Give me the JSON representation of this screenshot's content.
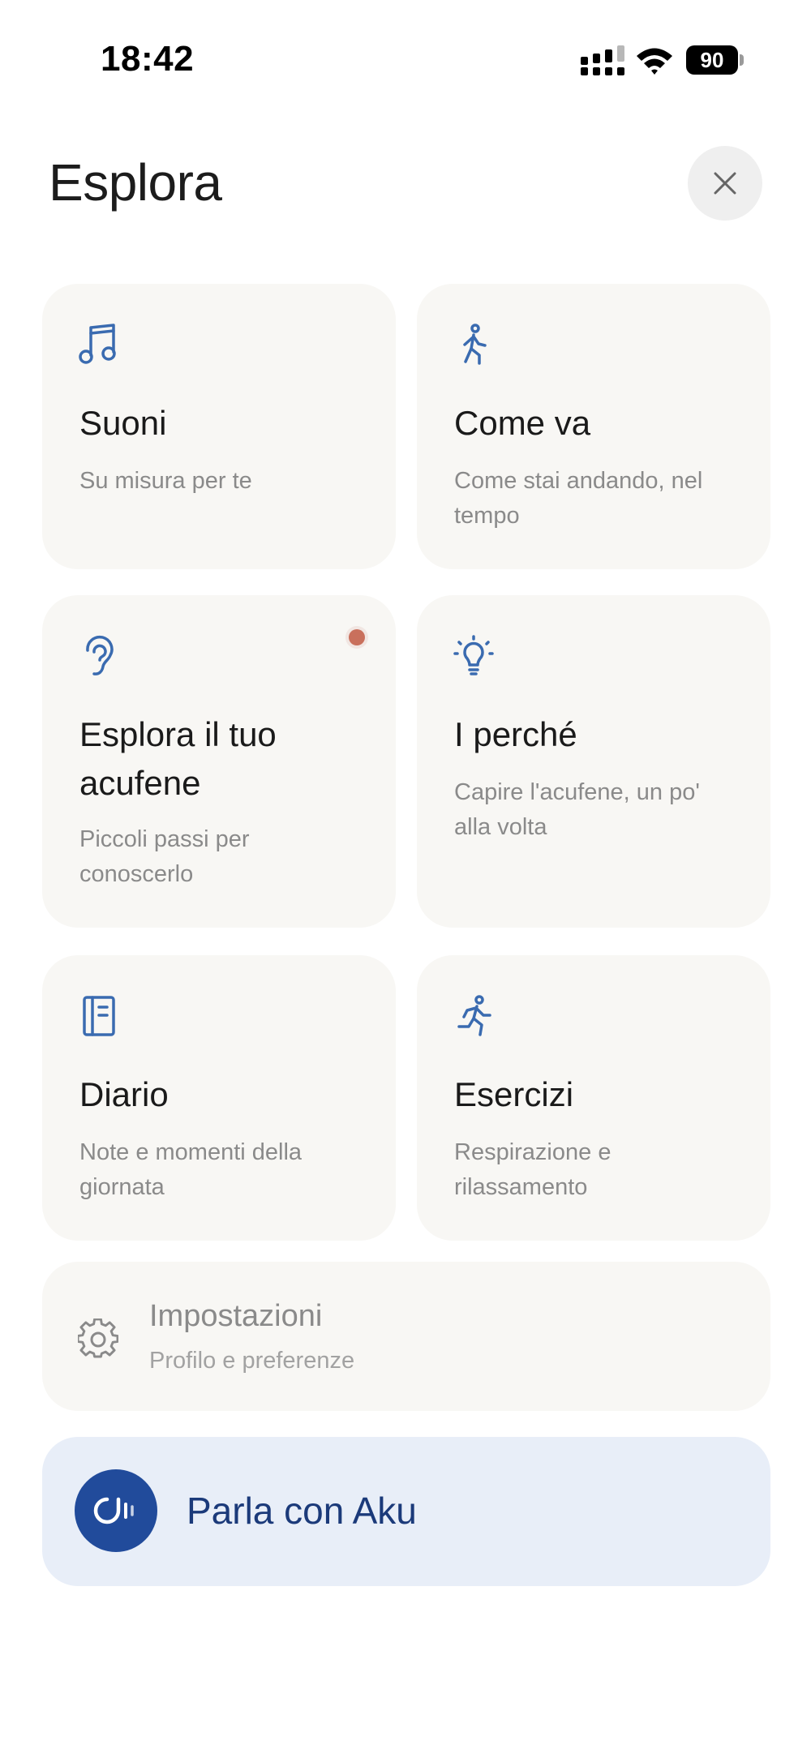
{
  "status_bar": {
    "time": "18:42",
    "battery_level": "90",
    "signal_icon": "signal-bars-icon",
    "wifi_icon": "wifi-icon"
  },
  "header": {
    "title": "Esplora",
    "close_icon": "close-icon"
  },
  "cards": [
    {
      "id": "suoni",
      "title": "Suoni",
      "subtitle": "Su misura per te",
      "icon": "music-note-icon"
    },
    {
      "id": "come-va",
      "title": "Come va",
      "subtitle": "Come stai andando, nel tempo",
      "icon": "walking-person-icon"
    },
    {
      "id": "esplora-acufene",
      "title": "Esplora il tuo acufene",
      "subtitle": "Piccoli passi per conoscerlo",
      "icon": "ear-icon",
      "has_badge": true
    },
    {
      "id": "i-perche",
      "title": "I perché",
      "subtitle": "Capire l'acufene, un po' alla volta",
      "icon": "lightbulb-icon"
    },
    {
      "id": "diario",
      "title": "Diario",
      "subtitle": "Note e momenti della giornata",
      "icon": "notebook-icon"
    },
    {
      "id": "esercizi",
      "title": "Esercizi",
      "subtitle": "Respirazione e rilassamento",
      "icon": "running-person-icon"
    }
  ],
  "settings": {
    "label": "Impostazioni",
    "subtitle": "Profilo e preferenze",
    "icon": "gear-icon"
  },
  "aku": {
    "label": "Parla con Aku",
    "icon": "aku-voice-icon"
  },
  "colors": {
    "accent": "#3a6bb0",
    "card_bg": "#f8f7f4",
    "aku_bg": "#e8eef8",
    "aku_avatar": "#214b9b",
    "badge": "#c9705c"
  }
}
